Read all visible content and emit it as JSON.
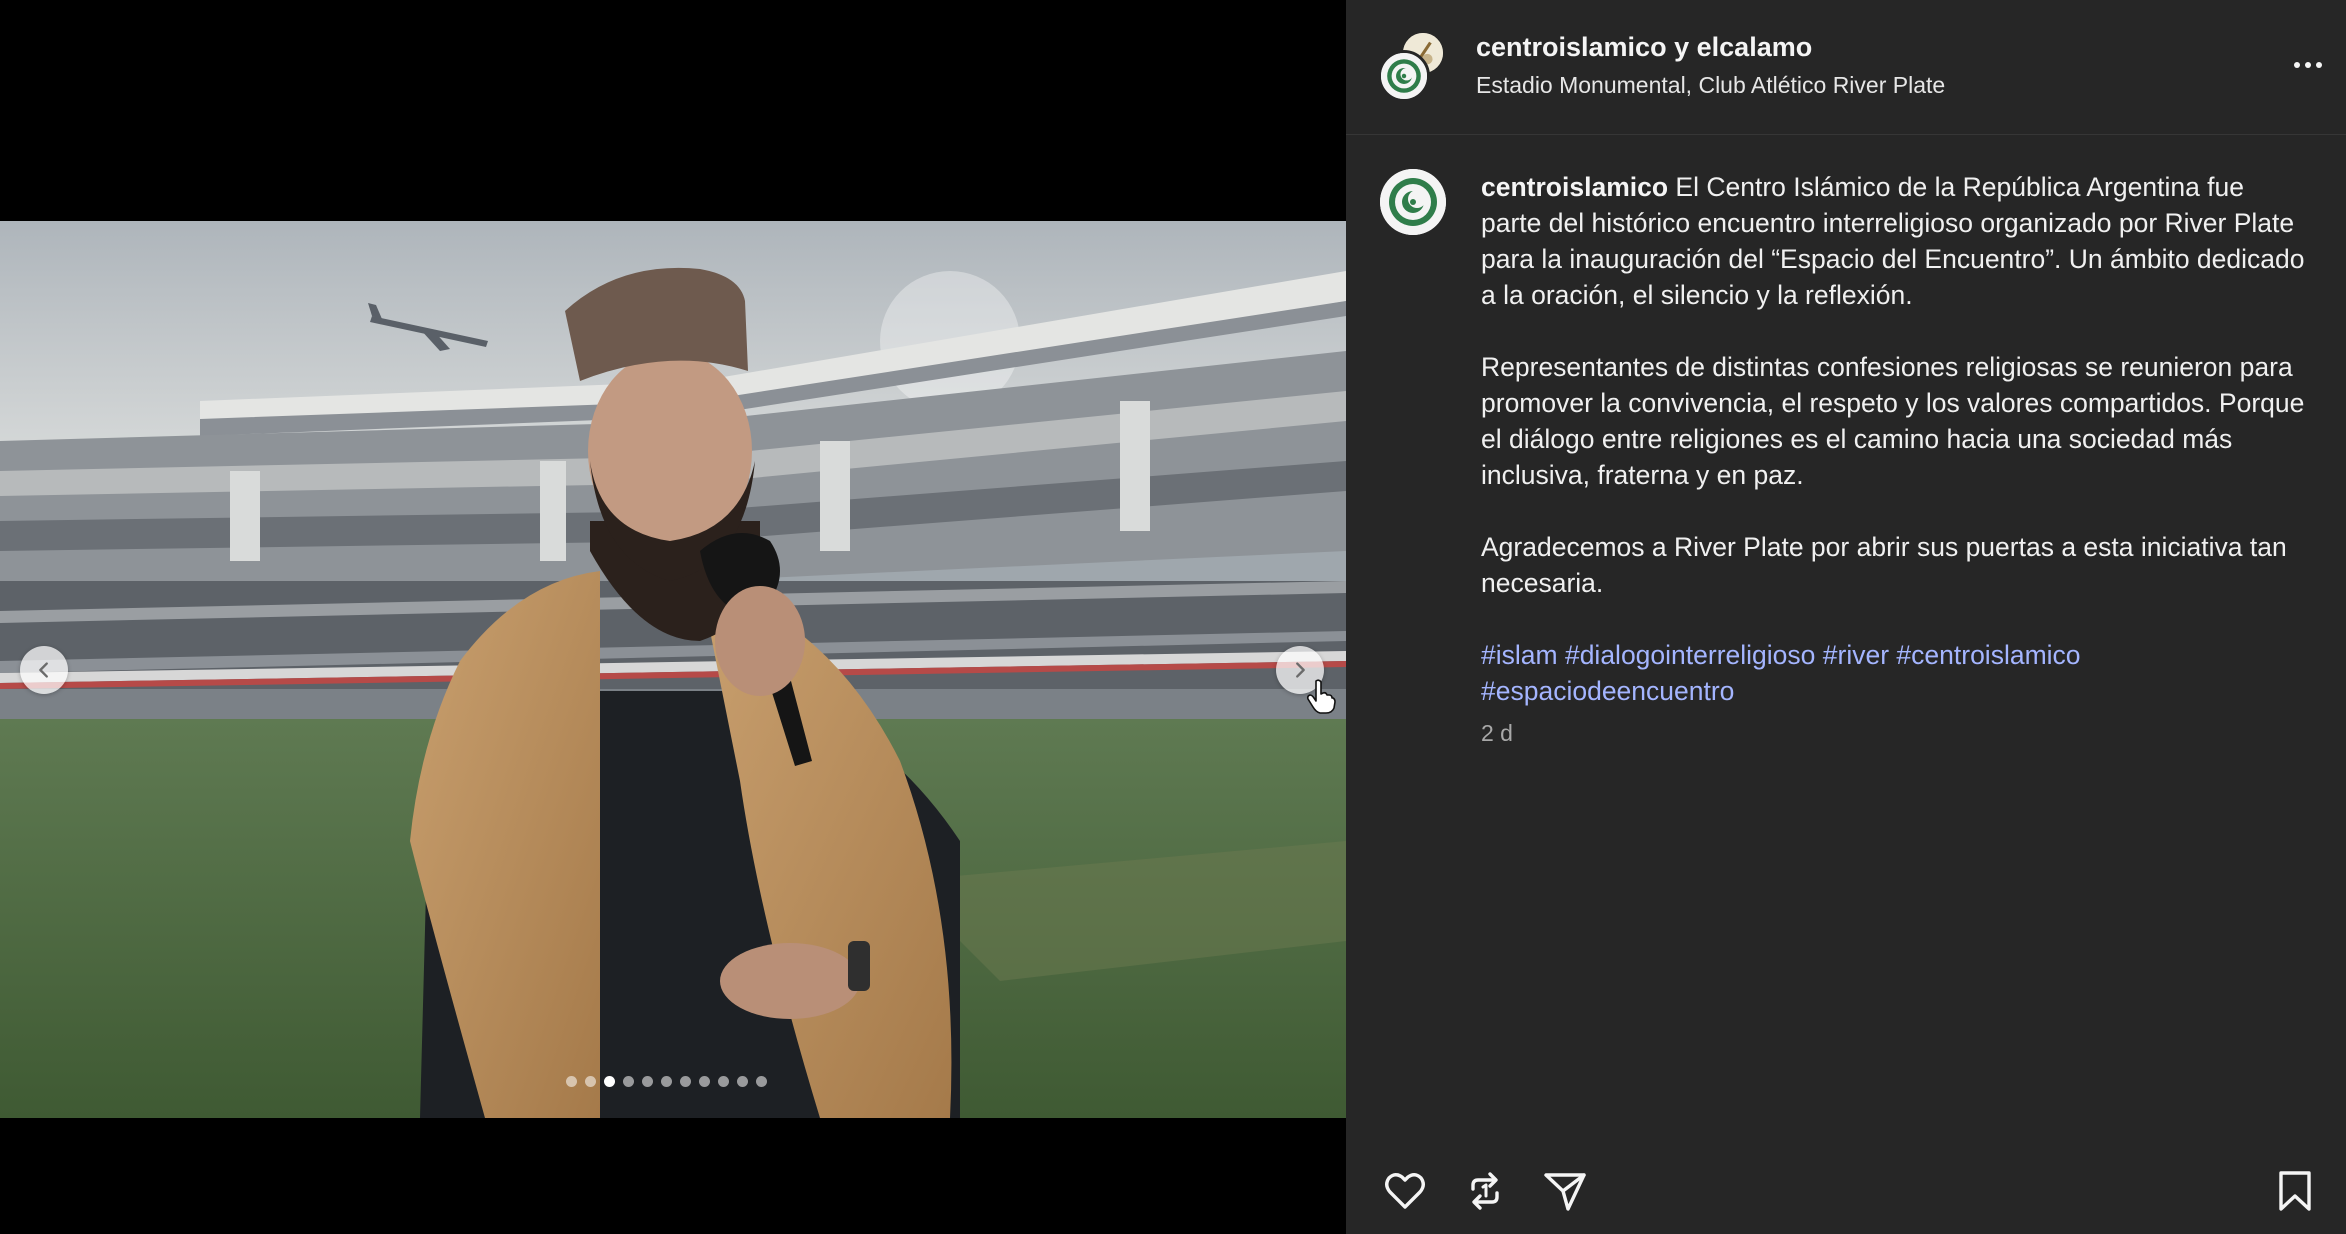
{
  "post": {
    "header": {
      "username_primary": "centroislamico",
      "username_joiner": "y",
      "username_secondary": "elcalamo",
      "location": "Estadio Monumental, Club Atlético River Plate"
    },
    "caption": {
      "username": "centroislamico",
      "paragraph_1": "El Centro Islámico de la República Argentina fue parte del histórico encuentro interreligioso organizado por River Plate para la inauguración del “Espacio del Encuentro”. Un ámbito dedicado a la oración, el silencio y la reflexión.",
      "paragraph_2": "Representantes de distintas confesiones religiosas se reunieron para promover la convivencia, el respeto y los valores compartidos. Porque el diálogo entre religiones es el camino hacia una sociedad más inclusiva, fraterna y en paz.",
      "paragraph_3": "Agradecemos a River Plate por abrir sus puertas a esta iniciativa tan necesaria.",
      "hashtags": [
        "#islam",
        "#dialogointerreligioso",
        "#river",
        "#centroislamico",
        "#espaciodeencuentro"
      ],
      "time": "2 d"
    },
    "carousel": {
      "total_slides": 11,
      "active_index": 2
    }
  },
  "icons": {
    "prev": "chevron-left-icon",
    "next": "chevron-right-icon",
    "more": "more-options-icon",
    "like": "heart-icon",
    "repost": "repost-icon",
    "share": "send-icon",
    "save": "bookmark-icon"
  },
  "colors": {
    "panel_bg": "#262626",
    "hashtag": "#a4b5ff",
    "muted_text": "#a8a8a8"
  }
}
